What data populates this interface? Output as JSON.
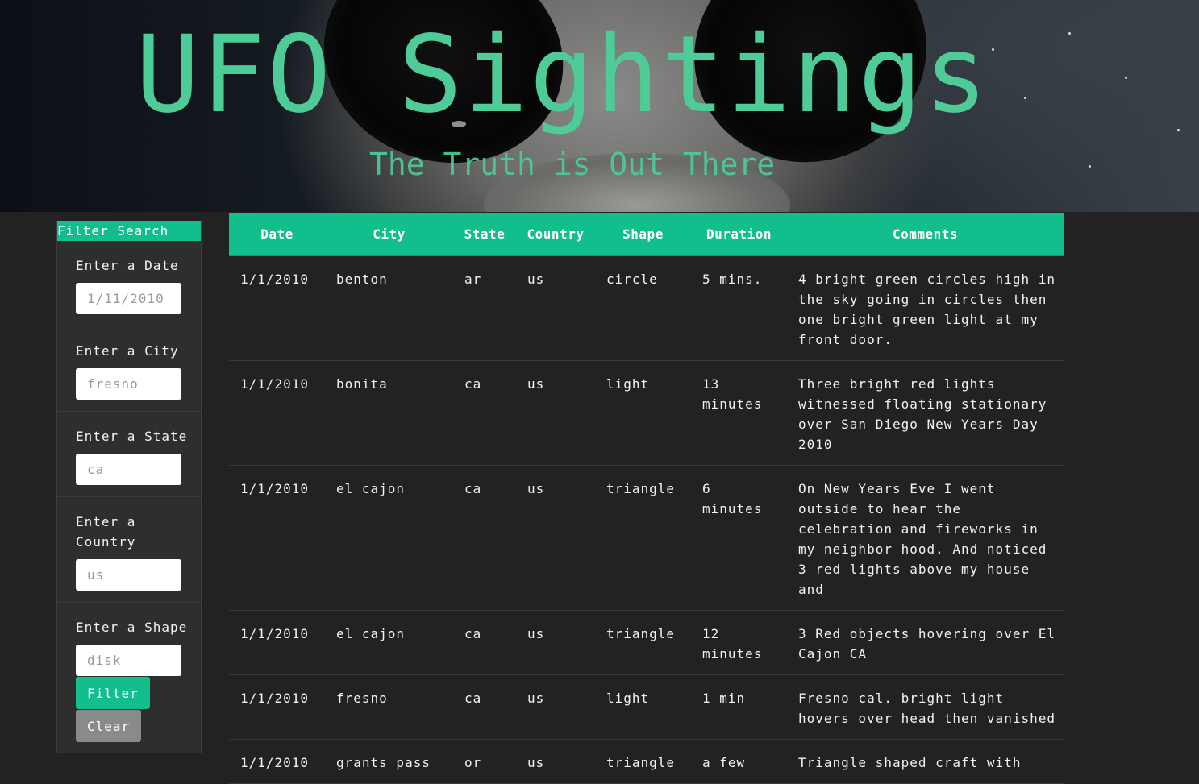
{
  "header": {
    "title": "UFO Sightings",
    "subtitle": "The Truth is Out There"
  },
  "sidebar": {
    "heading": "Filter Search",
    "filters": [
      {
        "label": "Enter a Date",
        "placeholder": "1/11/2010",
        "value": ""
      },
      {
        "label": "Enter a City",
        "placeholder": "fresno",
        "value": ""
      },
      {
        "label": "Enter a State",
        "placeholder": "ca",
        "value": ""
      },
      {
        "label": "Enter a Country",
        "placeholder": "us",
        "value": ""
      },
      {
        "label": "Enter a Shape",
        "placeholder": "disk",
        "value": ""
      }
    ],
    "filter_button": "Filter",
    "clear_button": "Clear"
  },
  "table": {
    "columns": [
      "Date",
      "City",
      "State",
      "Country",
      "Shape",
      "Duration",
      "Comments"
    ],
    "rows": [
      [
        "1/1/2010",
        "benton",
        "ar",
        "us",
        "circle",
        "5 mins.",
        "4 bright green circles high in the sky going in circles then one bright green light at my front door."
      ],
      [
        "1/1/2010",
        "bonita",
        "ca",
        "us",
        "light",
        "13 minutes",
        "Three bright red lights witnessed floating stationary over San Diego New Years Day 2010"
      ],
      [
        "1/1/2010",
        "el cajon",
        "ca",
        "us",
        "triangle",
        "6 minutes",
        "On New Years Eve I went outside to hear the celebration and fireworks in my neighbor hood. And noticed 3 red lights above my house and"
      ],
      [
        "1/1/2010",
        "el cajon",
        "ca",
        "us",
        "triangle",
        "12 minutes",
        "3 Red objects hovering over El Cajon CA"
      ],
      [
        "1/1/2010",
        "fresno",
        "ca",
        "us",
        "light",
        "1 min",
        "Fresno cal. bright light hovers over head then vanished"
      ],
      [
        "1/1/2010",
        "grants pass",
        "or",
        "us",
        "triangle",
        "a few",
        "Triangle shaped craft with"
      ]
    ]
  },
  "colors": {
    "accent": "#12bf8c",
    "title_green": "#4ecb96",
    "background": "#222222",
    "clear_button": "#8a8a8a"
  }
}
